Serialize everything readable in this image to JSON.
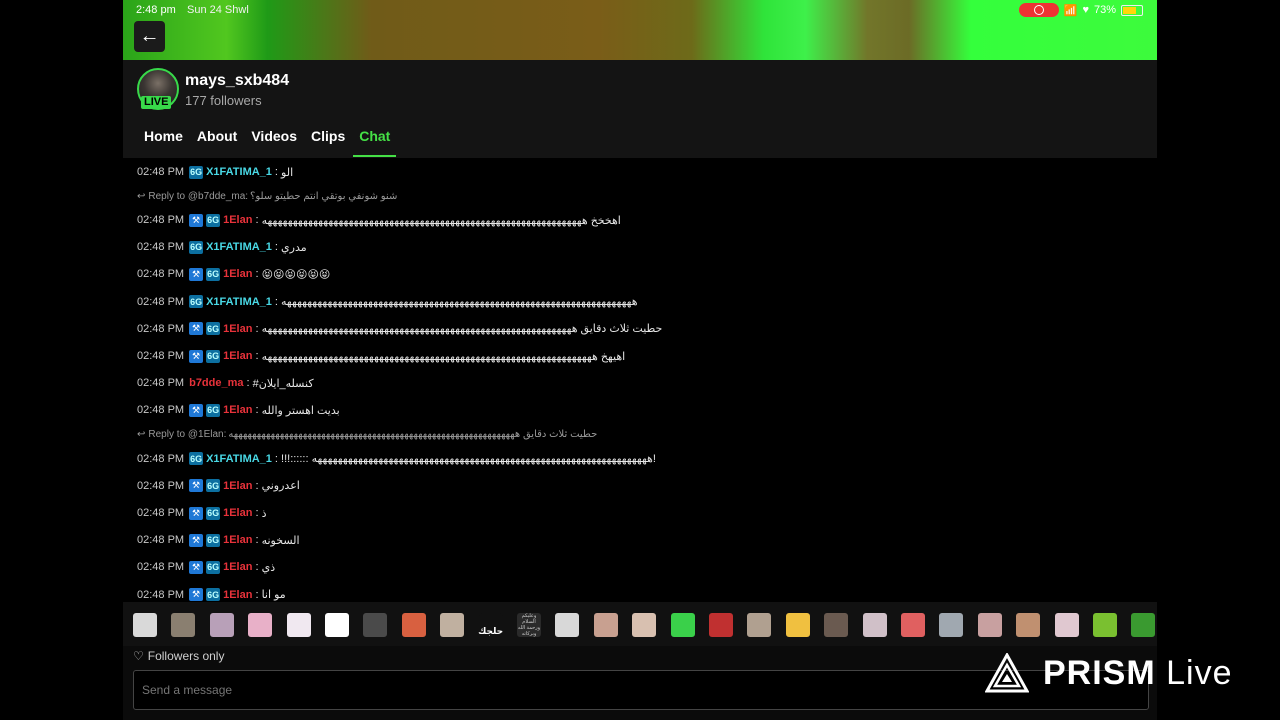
{
  "status_bar": {
    "time": "2:48 pm",
    "date": "Sun 24 Shwl",
    "battery": "73%",
    "battery_level": 0.73
  },
  "channel": {
    "name": "mays_sxb484",
    "followers": "177 followers",
    "live_label": "LIVE"
  },
  "tabs": [
    {
      "label": "Home",
      "active": false
    },
    {
      "label": "About",
      "active": false
    },
    {
      "label": "Videos",
      "active": false
    },
    {
      "label": "Clips",
      "active": false
    },
    {
      "label": "Chat",
      "active": true
    }
  ],
  "badges": {
    "mod_glyph": "⚒",
    "sub_glyph": "6G"
  },
  "messages": [
    {
      "time": "02:48 PM",
      "user": "X1FATIMA_1",
      "color": "cyan",
      "badges": [
        "sub"
      ],
      "text": "الو"
    },
    {
      "time": "02:48 PM",
      "user": "1Elan",
      "color": "red",
      "badges": [
        "mod",
        "sub"
      ],
      "text": "اهخخخ هههههههههههههههههههههههههههههههههههههههههههههههههههههههههههههههه",
      "reply": {
        "to": "Reply to @b7dde_ma:",
        "text": "شنو شونفي بوتقي انتم حطيتو سلو؟"
      }
    },
    {
      "time": "02:48 PM",
      "user": "X1FATIMA_1",
      "color": "cyan",
      "badges": [
        "sub"
      ],
      "text": "مدري"
    },
    {
      "time": "02:48 PM",
      "user": "1Elan",
      "color": "red",
      "badges": [
        "mod",
        "sub"
      ],
      "text": "😝😝😝😝😝😝"
    },
    {
      "time": "02:48 PM",
      "user": "X1FATIMA_1",
      "color": "cyan",
      "badges": [
        "sub"
      ],
      "text": "هههههههههههههههههههههههههههههههههههههههههههههههههههههههههههههههههههههه"
    },
    {
      "time": "02:48 PM",
      "user": "1Elan",
      "color": "red",
      "badges": [
        "mod",
        "sub"
      ],
      "text": "حطيت ثلاث دقايق هههههههههههههههههههههههههههههههههههههههههههههههههههههههههههههه"
    },
    {
      "time": "02:48 PM",
      "user": "1Elan",
      "color": "red",
      "badges": [
        "mod",
        "sub"
      ],
      "text": "اهيهخ هههههههههههههههههههههههههههههههههههههههههههههههههههههههههههههههههه"
    },
    {
      "time": "02:48 PM",
      "user": "b7dde_ma",
      "color": "red",
      "badges": [],
      "text": "#كنسله_ايلان"
    },
    {
      "time": "02:48 PM",
      "user": "1Elan",
      "color": "red",
      "badges": [
        "mod",
        "sub"
      ],
      "text": "بديت اهستر والله"
    },
    {
      "time": "02:48 PM",
      "user": "X1FATIMA_1",
      "color": "cyan",
      "badges": [
        "sub"
      ],
      "text": "!!!:::::: ههههههههههههههههههههههههههههههههههههههههههههههههههههههههههههههههههه!",
      "reply": {
        "to": "Reply to @1Elan:",
        "text": "حطيت ثلاث دقايق ههههههههههههههههههههههههههههههههههههههههههههههههههههههههههههههه"
      }
    },
    {
      "time": "02:48 PM",
      "user": "1Elan",
      "color": "red",
      "badges": [
        "mod",
        "sub"
      ],
      "text": "اعدروني"
    },
    {
      "time": "02:48 PM",
      "user": "1Elan",
      "color": "red",
      "badges": [
        "mod",
        "sub"
      ],
      "text": "ذ"
    },
    {
      "time": "02:48 PM",
      "user": "1Elan",
      "color": "red",
      "badges": [
        "mod",
        "sub"
      ],
      "text": "السخونه"
    },
    {
      "time": "02:48 PM",
      "user": "1Elan",
      "color": "red",
      "badges": [
        "mod",
        "sub"
      ],
      "text": "ذي"
    },
    {
      "time": "02:48 PM",
      "user": "1Elan",
      "color": "red",
      "badges": [
        "mod",
        "sub"
      ],
      "text": "مو انا"
    }
  ],
  "emotes": [
    "#d9d9d9",
    "#8a7f70",
    "#b8a0b8",
    "#e8b0c8",
    "#f0e8f0",
    "#ffffff",
    "#4a4a4a",
    "#d86040",
    "#c0b0a0",
    "#111111",
    "#2a2a2a",
    "#d8d8d8",
    "#c8a090",
    "#d8c0b0",
    "#3ad04a",
    "#c03030",
    "#b0a090",
    "#f0c040",
    "#6a5a50",
    "#d0c0c8",
    "#e06060",
    "#a0a8b0",
    "#c8a0a0",
    "#c09070",
    "#e0c8d0",
    "#7ac030",
    "#3a9a30"
  ],
  "emote_labels": {
    "text_emote": "حلجك",
    "text_emote2": "وعليكم السلام ورحمة الله وبركاته"
  },
  "footer": {
    "followers_only": "Followers only",
    "input_placeholder": "Send a message"
  },
  "watermark": {
    "brand": "PRISM",
    "suffix": " Live"
  },
  "colors": {
    "accent_green": "#45e046",
    "username_cyan": "#49d9e6",
    "username_red": "#e8323a",
    "mod_badge": "#1f78d6"
  }
}
